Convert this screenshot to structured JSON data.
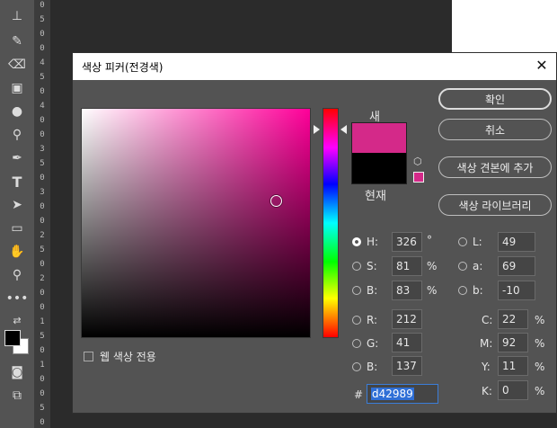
{
  "toolbar": {
    "tools": [
      "stamp-icon",
      "history-brush-icon",
      "eraser-icon",
      "gradient-icon",
      "blur-icon",
      "dodge-icon",
      "pen-icon",
      "type-icon",
      "path-select-icon",
      "rectangle-icon",
      "hand-icon",
      "zoom-icon",
      "more-icon",
      "swap-colors-icon",
      "quick-mask-icon",
      "screen-mode-icon"
    ],
    "foreground": "#000000",
    "background": "#ffffff"
  },
  "ruler": {
    "marks": [
      "0",
      "5",
      "0",
      "0",
      "4",
      "5",
      "0",
      "4",
      "0",
      "0",
      "3",
      "5",
      "0",
      "3",
      "0",
      "0",
      "2",
      "5",
      "0",
      "2",
      "0",
      "0",
      "1",
      "5",
      "0",
      "1",
      "0",
      "0",
      "5",
      "0"
    ]
  },
  "dialog": {
    "title": "색상 피커(전경색)",
    "close_label": "✕",
    "new_label": "새",
    "current_label": "현재",
    "new_color": "#d42989",
    "current_color": "#000000",
    "buttons": {
      "ok": "확인",
      "cancel": "취소",
      "add_swatch": "색상 견본에 추가",
      "libraries": "색상 라이브러리"
    },
    "web_only_label": "웹 색상 전용",
    "hsb": {
      "h_label": "H:",
      "h": "326",
      "h_unit": "°",
      "s_label": "S:",
      "s": "81",
      "s_unit": "%",
      "b_label": "B:",
      "b": "83",
      "b_unit": "%"
    },
    "rgb": {
      "r_label": "R:",
      "r": "212",
      "g_label": "G:",
      "g": "41",
      "b_label": "B:",
      "b": "137"
    },
    "lab": {
      "l_label": "L:",
      "l": "49",
      "a_label": "a:",
      "a": "69",
      "b_label": "b:",
      "b": "-10"
    },
    "cmyk": {
      "c_label": "C:",
      "c": "22",
      "m_label": "M:",
      "m": "92",
      "y_label": "Y:",
      "y": "11",
      "k_label": "K:",
      "k": "0",
      "unit": "%"
    },
    "hex_label": "#",
    "hex": "d42989"
  }
}
